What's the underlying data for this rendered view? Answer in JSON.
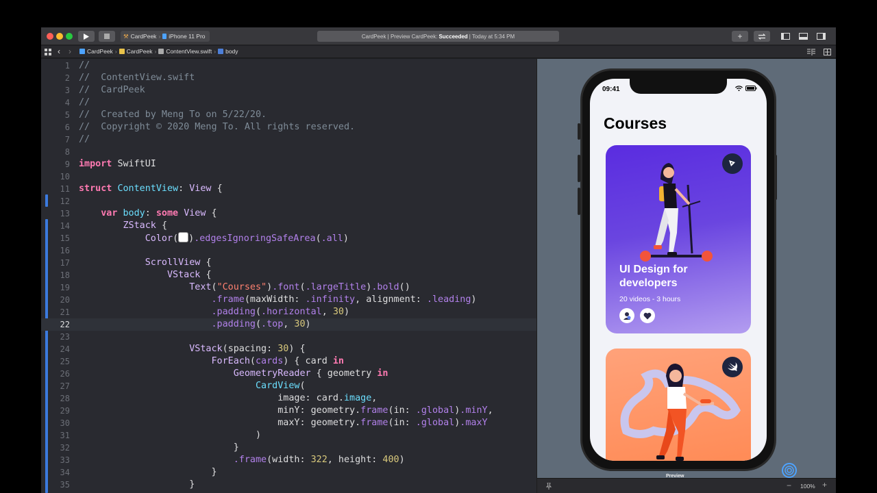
{
  "toolbar": {
    "scheme_project": "CardPeek",
    "scheme_device": "iPhone 11 Pro",
    "activity_prefix": "CardPeek | Preview CardPeek:",
    "activity_status": "Succeeded",
    "activity_suffix": "| Today at 5:34 PM",
    "add_label": "+"
  },
  "jumpbar": {
    "crumbs": [
      "CardPeek",
      "CardPeek",
      "ContentView.swift",
      "body"
    ]
  },
  "editor": {
    "current_line": 22,
    "lines": [
      {
        "n": "1"
      },
      {
        "n": "2"
      },
      {
        "n": "3"
      },
      {
        "n": "4"
      },
      {
        "n": "5"
      },
      {
        "n": "6"
      },
      {
        "n": "7"
      },
      {
        "n": "8"
      },
      {
        "n": "9"
      },
      {
        "n": "10"
      },
      {
        "n": "11"
      },
      {
        "n": "12"
      },
      {
        "n": "13"
      },
      {
        "n": "14"
      },
      {
        "n": "15"
      },
      {
        "n": "16"
      },
      {
        "n": "17"
      },
      {
        "n": "18"
      },
      {
        "n": "19"
      },
      {
        "n": "20"
      },
      {
        "n": "21"
      },
      {
        "n": "22"
      },
      {
        "n": "23"
      },
      {
        "n": "24"
      },
      {
        "n": "25"
      },
      {
        "n": "26"
      },
      {
        "n": "27"
      },
      {
        "n": "28"
      },
      {
        "n": "29"
      },
      {
        "n": "30"
      },
      {
        "n": "31"
      },
      {
        "n": "32"
      },
      {
        "n": "33"
      },
      {
        "n": "34"
      },
      {
        "n": "35"
      }
    ],
    "tokens": {
      "c1": "//",
      "c2": "//  ContentView.swift",
      "c3": "//  CardPeek",
      "c4": "//",
      "c5": "//  Created by Meng To on 5/22/20.",
      "c6": "//  Copyright © 2020 Meng To. All rights reserved.",
      "c7": "//",
      "import": "import",
      "swiftui": "SwiftUI",
      "struct": "struct",
      "contentview": "ContentView",
      "colon": ":",
      "view": "View",
      "brace_open": "{",
      "var": "var",
      "body": "body",
      "some": "some",
      "zstack": "ZStack",
      "color": "Color",
      "paren_open": "(",
      "paren_close": ")",
      "edges": ".edgesIgnoringSafeArea",
      "all": ".all",
      "scrollview": "ScrollView",
      "vstack": "VStack",
      "text": "Text",
      "courses_str": "\"Courses\"",
      "font": ".font",
      "largetitle": ".largeTitle",
      "bold": ".bold",
      "frame": ".frame",
      "maxwidth": "maxWidth:",
      "infinity": ".infinity",
      "alignment": "alignment:",
      "leading": ".leading",
      "padding": ".padding",
      "horizontal": ".horizontal",
      "top": ".top",
      "thirty": "30",
      "spacing": "spacing:",
      "foreach": "ForEach",
      "cards": "cards",
      "card": "card",
      "in": "in",
      "geometryreader": "GeometryReader",
      "geometry": "geometry",
      "cardview": "CardView",
      "image_label": "image:",
      "card_image": "card.",
      "image_prop": "image",
      "miny_label": "minY:",
      "maxy_label": "maxY:",
      "geometry_dot": "geometry.",
      "frame_call": "frame",
      "in_label": "in:",
      "global": ".global",
      "miny": ".minY",
      "maxy": ".maxY",
      "width_label": "width:",
      "height_label": "height:",
      "w322": "322",
      "h400": "400",
      "brace_close": "}",
      "comma": ",",
      "paren_close_only": ")"
    }
  },
  "preview": {
    "status_time": "09:41",
    "large_title": "Courses",
    "card1_title": "UI Design for developers",
    "card1_subtitle": "20 videos - 3 hours",
    "preview_label": "Preview",
    "zoom": "100%"
  },
  "colors": {
    "accent_blue": "#3b7adf",
    "card1_top": "#5a2ce0",
    "card2_top": "#ffa27a",
    "keyword_pink": "#ff7ab2",
    "string_red": "#ff8170"
  }
}
